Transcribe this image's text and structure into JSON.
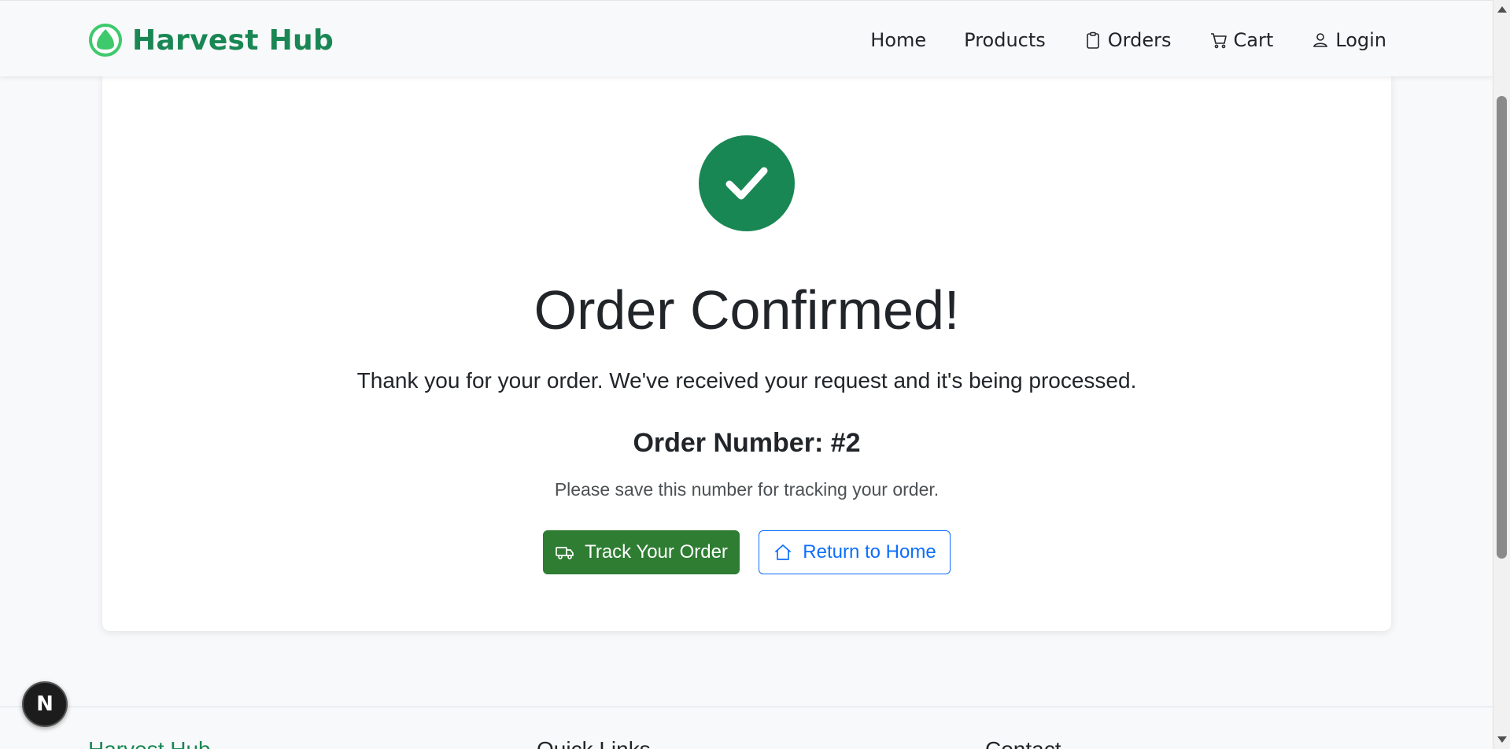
{
  "navbar": {
    "brand_name": "Harvest Hub",
    "brand_icon": "leaf-circle-icon",
    "links": [
      {
        "label": "Home",
        "icon": null
      },
      {
        "label": "Products",
        "icon": null
      },
      {
        "label": "Orders",
        "icon": "clipboard-icon"
      },
      {
        "label": "Cart",
        "icon": "cart-icon"
      },
      {
        "label": "Login",
        "icon": "person-icon"
      }
    ]
  },
  "confirmation": {
    "title": "Order Confirmed!",
    "message": "Thank you for your order. We've received your request and it's being processed.",
    "order_number": "Order Number: #2",
    "hint": "Please save this number for tracking your order.",
    "track_button": "Track Your Order",
    "home_button": "Return to Home"
  },
  "footer": {
    "brand": "Harvest Hub",
    "quick_links": "Quick Links",
    "contact": "Contact"
  },
  "badge": {
    "label": "N"
  },
  "colors": {
    "brand": "#198754",
    "track_button": "#2e7d32",
    "home_button": "#0d6efd",
    "background": "#f8f9fa"
  }
}
